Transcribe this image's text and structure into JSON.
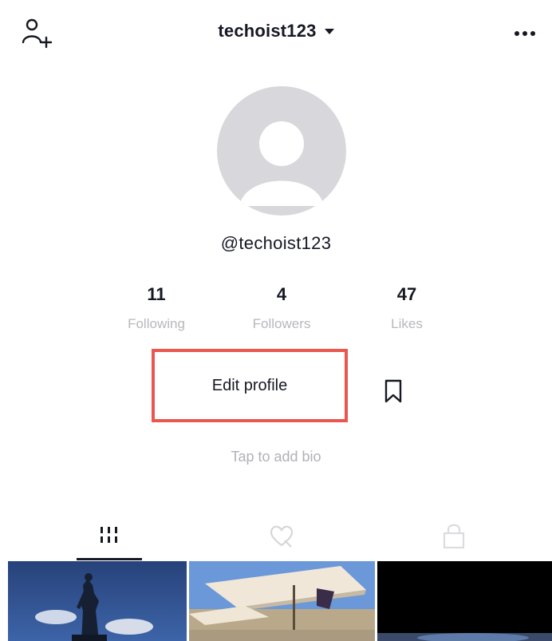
{
  "header": {
    "username_title": "techoist123",
    "add_user_icon": "add-user-icon",
    "more_icon": "more-horizontal-icon"
  },
  "profile": {
    "handle": "@techoist123",
    "avatar_icon": "default-avatar-icon"
  },
  "stats": [
    {
      "value": "11",
      "label": "Following"
    },
    {
      "value": "4",
      "label": "Followers"
    },
    {
      "value": "47",
      "label": "Likes"
    }
  ],
  "actions": {
    "edit_profile_label": "Edit profile",
    "bookmark_icon": "bookmark-icon",
    "highlight_color": "#e9574e"
  },
  "bio": {
    "placeholder": "Tap to add bio"
  },
  "tabs": [
    {
      "icon": "grid-icon",
      "active": true
    },
    {
      "icon": "liked-heart-icon",
      "active": false
    },
    {
      "icon": "lock-icon",
      "active": false
    }
  ],
  "videos": [
    {
      "thumbnail": "statue-sky-thumbnail"
    },
    {
      "thumbnail": "beach-umbrella-thumbnail"
    },
    {
      "thumbnail": "dark-thumbnail"
    }
  ]
}
